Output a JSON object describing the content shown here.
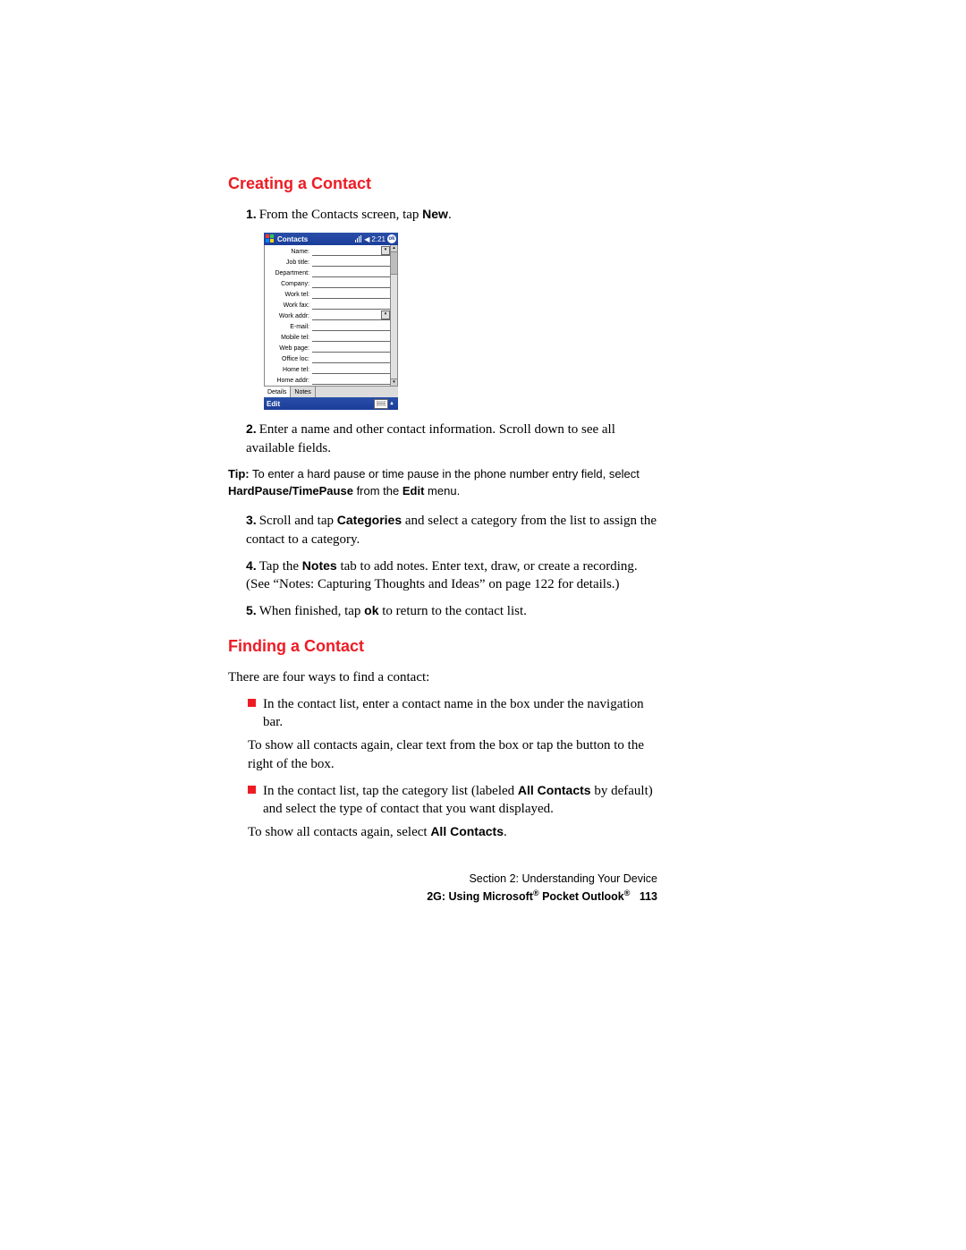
{
  "headings": {
    "creating": "Creating a Contact",
    "finding": "Finding a Contact"
  },
  "steps": {
    "s1_pre": "From the Contacts screen, tap ",
    "s1_b": "New",
    "s1_post": ".",
    "s2": "Enter a name and other contact information. Scroll down to see all available fields.",
    "s3_pre": "Scroll and tap ",
    "s3_b": "Categories",
    "s3_post": " and select a category from the list to assign the contact to a category.",
    "s4_pre": "Tap the ",
    "s4_b": "Notes",
    "s4_post": " tab to add notes. Enter text, draw, or create a recording. (See “Notes: Capturing Thoughts and Ideas” on page 122 for details.)",
    "s5_pre": "When finished, tap ",
    "s5_b": "ok",
    "s5_post": " to return to the contact list."
  },
  "tip": {
    "label": "Tip:",
    "line1": " To enter a hard pause or time pause in the phone number entry field, select ",
    "bold1": "HardPause/TimePause",
    "mid": " from the ",
    "bold2": "Edit",
    "end": " menu."
  },
  "finding": {
    "intro": "There are four ways to find a contact:",
    "b1": "In the contact list, enter a contact name in the box under the navigation bar.",
    "b1_sub": "To show all contacts again, clear text from the box or tap the button to the right of the box.",
    "b2_pre": "In the contact list, tap the category list (labeled ",
    "b2_b": "All Contacts",
    "b2_post": " by default) and select the type of contact that you want displayed.",
    "b2_sub_pre": "To show all contacts again, select ",
    "b2_sub_b": "All Contacts",
    "b2_sub_post": "."
  },
  "footer": {
    "line1": "Section 2: Understanding Your Device",
    "line2_pre": "2G: Using Microsoft",
    "reg1": "®",
    "line2_mid": " Pocket Outlook",
    "reg2": "®",
    "page": "113"
  },
  "pda": {
    "title": "Contacts",
    "time": "2:21",
    "ok": "ok",
    "fields": [
      "Name:",
      "Job title:",
      "Department:",
      "Company:",
      "Work tel:",
      "Work fax:",
      "Work addr:",
      "E-mail:",
      "Mobile tel:",
      "Web page:",
      "Office loc:",
      "Home tel:",
      "Home addr:"
    ],
    "tab_details": "Details",
    "tab_notes": "Notes",
    "edit": "Edit"
  }
}
